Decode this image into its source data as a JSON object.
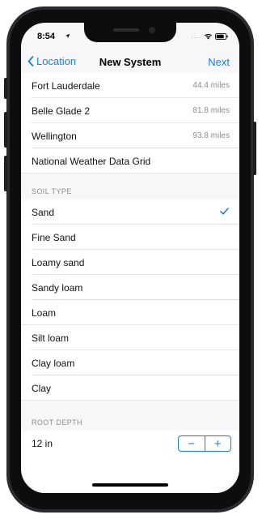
{
  "status": {
    "time": "8:54",
    "signal_dots": "...."
  },
  "nav": {
    "back_label": "Location",
    "title": "New System",
    "next_label": "Next"
  },
  "stations": [
    {
      "name": "Fort Lauderdale",
      "distance": "44.4 miles"
    },
    {
      "name": "Belle Glade 2",
      "distance": "81.8 miles"
    },
    {
      "name": "Wellington",
      "distance": "93.8 miles"
    }
  ],
  "grid_option": "National Weather Data Grid",
  "soil": {
    "header": "SOIL TYPE",
    "selected": "Sand",
    "options": [
      "Sand",
      "Fine Sand",
      "Loamy sand",
      "Sandy loam",
      "Loam",
      "Silt loam",
      "Clay loam",
      "Clay"
    ]
  },
  "root_depth": {
    "header": "ROOT DEPTH",
    "value": "12 in",
    "minus": "−",
    "plus": "+"
  },
  "colors": {
    "accent": "#1a7fe3",
    "background": "#f7f7f9"
  }
}
